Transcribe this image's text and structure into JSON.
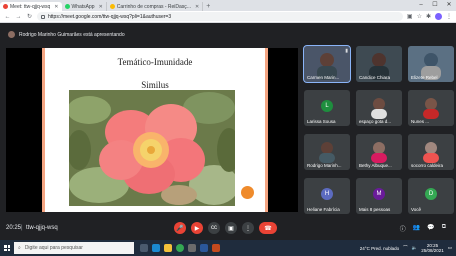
{
  "browser": {
    "tabs": [
      {
        "label": "Meet: ttw-qjjq-wsq",
        "favicon_color": "#ea4335",
        "active": true
      },
      {
        "label": "WhatsApp",
        "favicon_color": "#25d366",
        "active": false
      },
      {
        "label": "Carrinho de compras - ReiDasç...",
        "favicon_color": "#fbbc04",
        "active": false
      }
    ],
    "new_tab": "+",
    "url": "https://meet.google.com/ttw-qjjq-wsq?pli=1&authuser=3"
  },
  "meet": {
    "presenter_text": "Rodrigo Marinho Guimarães está apresentando",
    "slide": {
      "title": "Temático-Imunidade",
      "subtitle": "Similus"
    },
    "participants": [
      {
        "name": "Carmen Marin...",
        "type": "video",
        "color": "#5d4037"
      },
      {
        "name": "Candice Chiara",
        "type": "video",
        "color": "#4e342e"
      },
      {
        "name": "Elizete Rebel",
        "type": "video",
        "color": "#3e5468"
      },
      {
        "name": "Larissa Sousa",
        "type": "avatar",
        "initial": "L",
        "color": "#1e8e3e"
      },
      {
        "name": "espaço gota d...",
        "type": "video",
        "color": "#6d4c41"
      },
      {
        "name": "Nunes ...",
        "type": "video",
        "color": "#795548"
      },
      {
        "name": "Rodrigo Marinh...",
        "type": "video",
        "color": "#5d4037"
      },
      {
        "name": "Bethy Albuque...",
        "type": "video",
        "color": "#8d6e63"
      },
      {
        "name": "socorro caldeira",
        "type": "video",
        "color": "#a1887f"
      },
      {
        "name": "Heliane Fabrícia",
        "type": "avatar",
        "initial": "H",
        "color": "#5c6bc0"
      },
      {
        "name": "Mais 8 pessoas",
        "type": "avatar",
        "initial": "M",
        "color": "#6a1b9a"
      },
      {
        "name": "Você",
        "type": "avatar",
        "initial": "D",
        "color": "#34a853"
      }
    ],
    "time": "20:25",
    "separator": "|",
    "meeting_code": "ttw-qjjq-wsq"
  },
  "taskbar": {
    "search_placeholder": "Digite aqui para pesquisar",
    "weather": "24°C  Pred. nublado",
    "clock_time": "20:25",
    "clock_date": "25/08/2021"
  }
}
